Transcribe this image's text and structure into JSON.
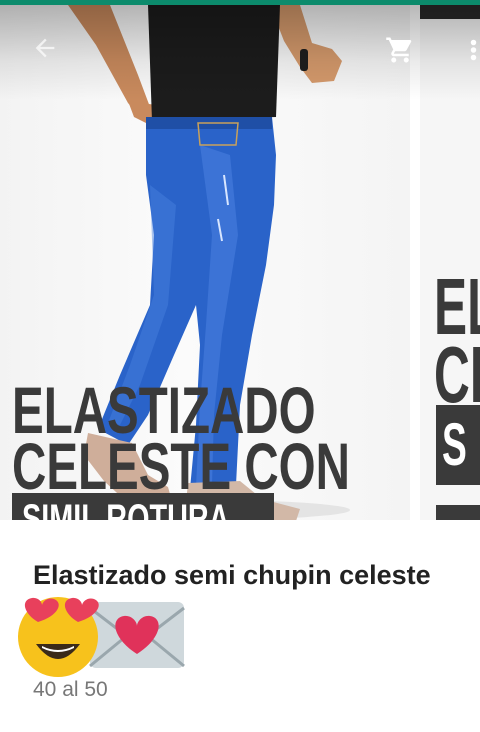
{
  "header": {
    "back_icon": "arrow-back-icon",
    "cart_icon": "shopping-cart-icon",
    "more_icon": "more-vert-icon"
  },
  "carousel": {
    "slide_1": {
      "caption_line1": "ELASTIZADO",
      "caption_line2": "CELESTE CON",
      "caption_line3": "SIMIL ROTURA"
    },
    "slide_2": {
      "caption_line1": "EL",
      "caption_line2": "CI",
      "caption_line3": "S"
    }
  },
  "product": {
    "title": "Elastizado semi chupin celeste",
    "emojis": [
      "heart-eyes-emoji",
      "love-letter-emoji"
    ],
    "sizes": "40 al 50"
  },
  "colors": {
    "status_strip": "#0c8b6c",
    "denim": "#2a63c9",
    "caption_dark": "#3a3a3a"
  }
}
